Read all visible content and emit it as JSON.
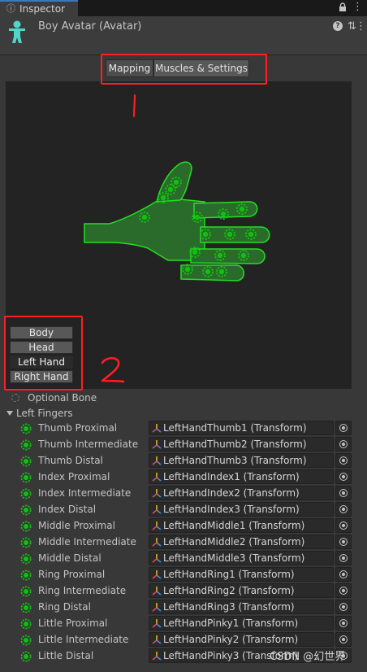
{
  "tab": {
    "title": "Inspector",
    "icon": "info-icon"
  },
  "header": {
    "title": "Boy Avatar (Avatar)",
    "icons": [
      "help-icon",
      "settings-icon",
      "more-icon"
    ]
  },
  "mode_toggle": {
    "mapping_label": "Mapping",
    "muscles_label": "Muscles & Settings",
    "selected": "Mapping"
  },
  "annotations": {
    "label_1": "1",
    "label_2": "2",
    "color": "#ff1f1f"
  },
  "body_parts": {
    "items": [
      "Body",
      "Head",
      "Left Hand",
      "Right Hand"
    ],
    "selected": "Left Hand"
  },
  "optional_bone": "Optional Bone",
  "foldout": {
    "label": "Left Fingers",
    "expanded": true
  },
  "bones": [
    {
      "label": "Thumb Proximal",
      "value": "LeftHandThumb1 (Transform)"
    },
    {
      "label": "Thumb Intermediate",
      "value": "LeftHandThumb2 (Transform)"
    },
    {
      "label": "Thumb Distal",
      "value": "LeftHandThumb3 (Transform)"
    },
    {
      "label": "Index Proximal",
      "value": "LeftHandIndex1 (Transform)"
    },
    {
      "label": "Index Intermediate",
      "value": "LeftHandIndex2 (Transform)"
    },
    {
      "label": "Index Distal",
      "value": "LeftHandIndex3 (Transform)"
    },
    {
      "label": "Middle Proximal",
      "value": "LeftHandMiddle1 (Transform)"
    },
    {
      "label": "Middle Intermediate",
      "value": "LeftHandMiddle2 (Transform)"
    },
    {
      "label": "Middle Distal",
      "value": "LeftHandMiddle3 (Transform)"
    },
    {
      "label": "Ring Proximal",
      "value": "LeftHandRing1 (Transform)"
    },
    {
      "label": "Ring Intermediate",
      "value": "LeftHandRing2 (Transform)"
    },
    {
      "label": "Ring Distal",
      "value": "LeftHandRing3 (Transform)"
    },
    {
      "label": "Little Proximal",
      "value": "LeftHandPinky1 (Transform)"
    },
    {
      "label": "Little Intermediate",
      "value": "LeftHandPinky2 (Transform)"
    },
    {
      "label": "Little Distal",
      "value": "LeftHandPinky3 (Transform)"
    }
  ],
  "watermark": "CSDN @幻世界",
  "colors": {
    "bone_green": "#10c010",
    "hand_outline": "#22e022",
    "hand_fill": "#2a6a2a"
  }
}
